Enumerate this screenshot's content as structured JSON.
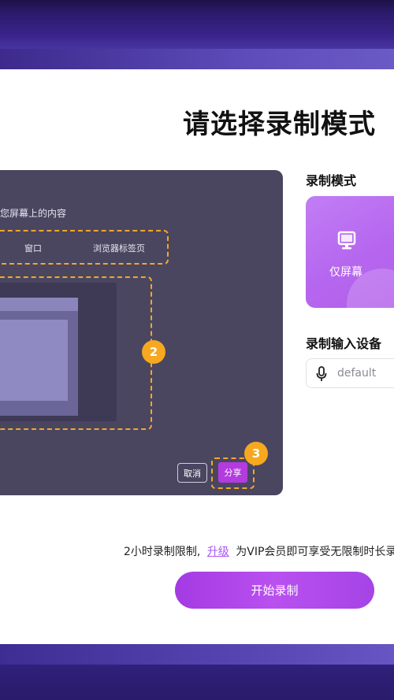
{
  "page": {
    "title": "请选择录制模式"
  },
  "preview": {
    "caption": "您屏幕上的内容",
    "tabs": [
      "窗口",
      "浏览器标签页"
    ],
    "step_badges": [
      "2",
      "3"
    ],
    "cancel_label": "取消",
    "share_label": "分享"
  },
  "mode_section": {
    "label": "录制模式",
    "selected_mode": {
      "label": "仅屏幕",
      "icon": "monitor-icon"
    }
  },
  "device_section": {
    "label": "录制输入设备",
    "value": "default",
    "icon": "microphone-icon"
  },
  "footer": {
    "limit_prefix": "2小时录制限制,",
    "upgrade_link": "升级",
    "limit_suffix": "为VIP会员即可享受无限制时长录",
    "start_button": "开始录制"
  },
  "colors": {
    "accent": "#b04be8",
    "badge": "#f6a81f",
    "preview_bg": "#4a4660",
    "band": "#3a238a"
  }
}
